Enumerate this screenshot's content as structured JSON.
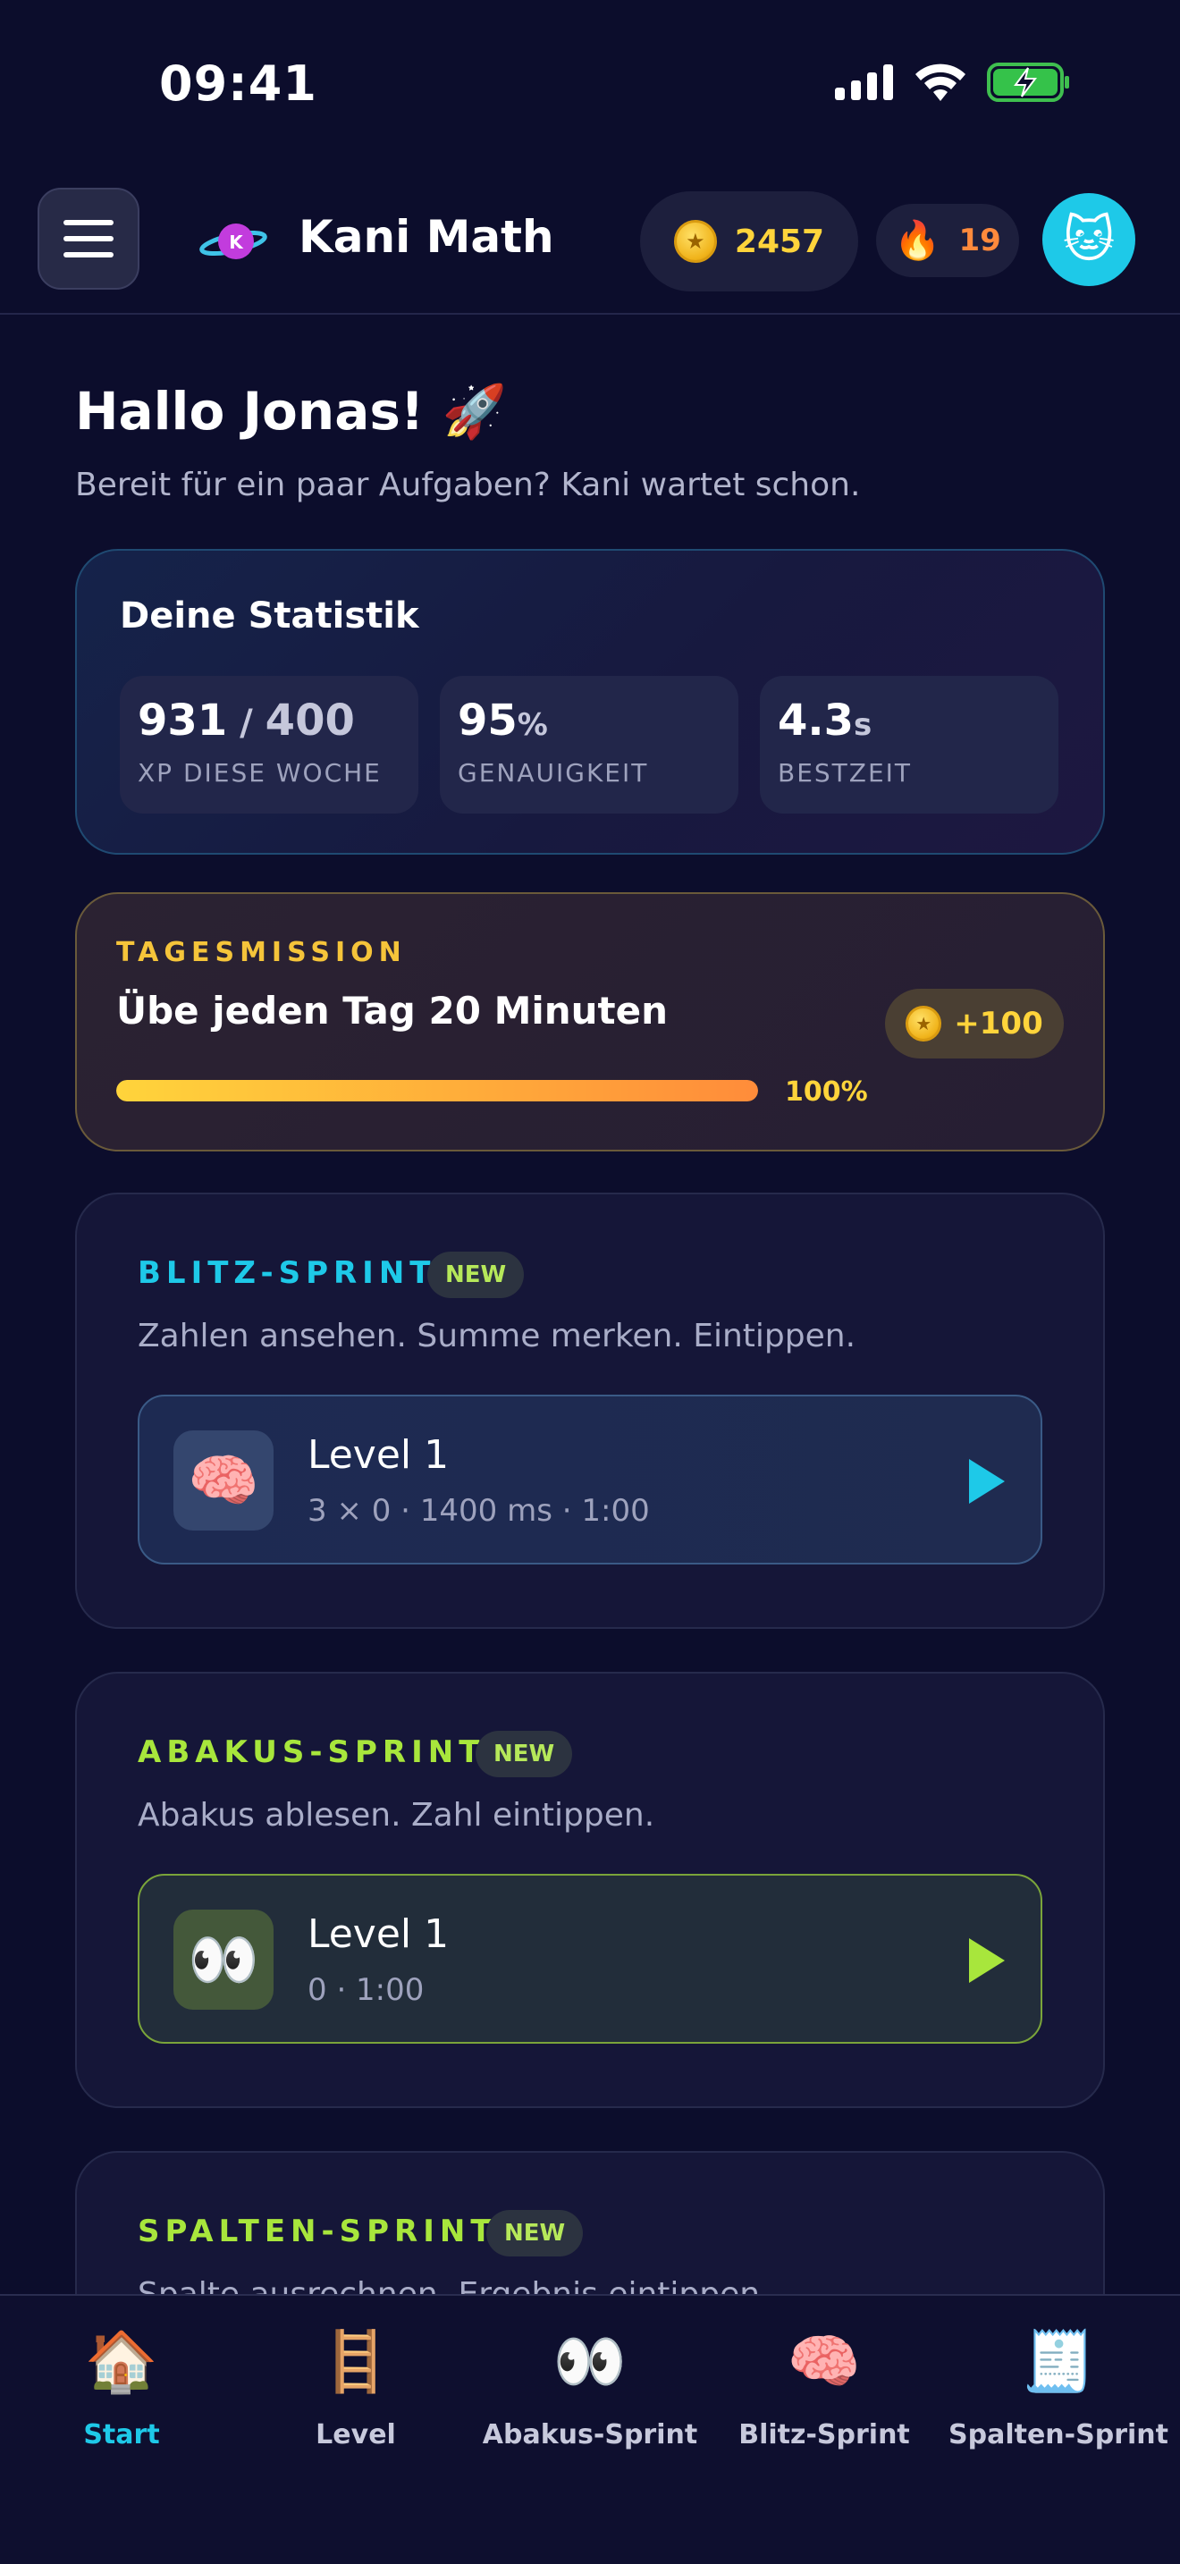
{
  "status_bar": {
    "time": "09:41"
  },
  "header": {
    "app_title": "Kani Math",
    "logo_letter": "K",
    "coins": "2457",
    "streak": "19",
    "avatar_icon": "🐱"
  },
  "greeting": {
    "title": "Hallo Jonas! 🚀",
    "subtitle": "Bereit für ein paar Aufgaben? Kani wartet schon."
  },
  "stats": {
    "title": "Deine Statistik",
    "xp_value": "931",
    "xp_sep": " / ",
    "xp_goal": "400",
    "xp_label": "XP DIESE WOCHE",
    "accuracy_value": "95",
    "accuracy_unit": "%",
    "accuracy_label": "GENAUIGKEIT",
    "best_value": "4.3",
    "best_unit": "s",
    "best_label": "BESTZEIT"
  },
  "mission": {
    "eyebrow": "TAGESMISSION",
    "title": "Übe jeden Tag 20 Minuten",
    "reward": "+100",
    "progress_label": "100%",
    "progress_fraction": 1.0
  },
  "games": [
    {
      "title": "BLITZ-SPRINT",
      "badge": "NEW",
      "description": "Zahlen ansehen. Summe merken. Eintippen.",
      "level": "Level 1",
      "meta": "3 × 0 · 1400 ms · 1:00",
      "icon": "🧠",
      "accent": "#1ec9e8"
    },
    {
      "title": "ABAKUS-SPRINT",
      "badge": "NEW",
      "description": "Abakus ablesen. Zahl eintippen.",
      "level": "Level 1",
      "meta": "0 · 1:00",
      "icon": "👀",
      "accent": "#a8e63c"
    },
    {
      "title": "SPALTEN-SPRINT",
      "badge": "NEW",
      "description": "Spalte ausrechnen. Ergebnis eintippen.",
      "accent": "#a8e63c"
    }
  ],
  "nav": [
    {
      "label": "Start",
      "icon": "🏠",
      "active": true
    },
    {
      "label": "Level",
      "icon": "🪜"
    },
    {
      "label": "Abakus-Sprint",
      "icon": "👀"
    },
    {
      "label": "Blitz-Sprint",
      "icon": "🧠"
    },
    {
      "label": "Spalten-Sprint",
      "icon": "🧾"
    }
  ],
  "colors": {
    "background": "#0c0d2c",
    "accent_cyan": "#1ec9e8",
    "accent_lime": "#a8e63c",
    "gold": "#ffd43b",
    "orange": "#ff8a3c"
  }
}
